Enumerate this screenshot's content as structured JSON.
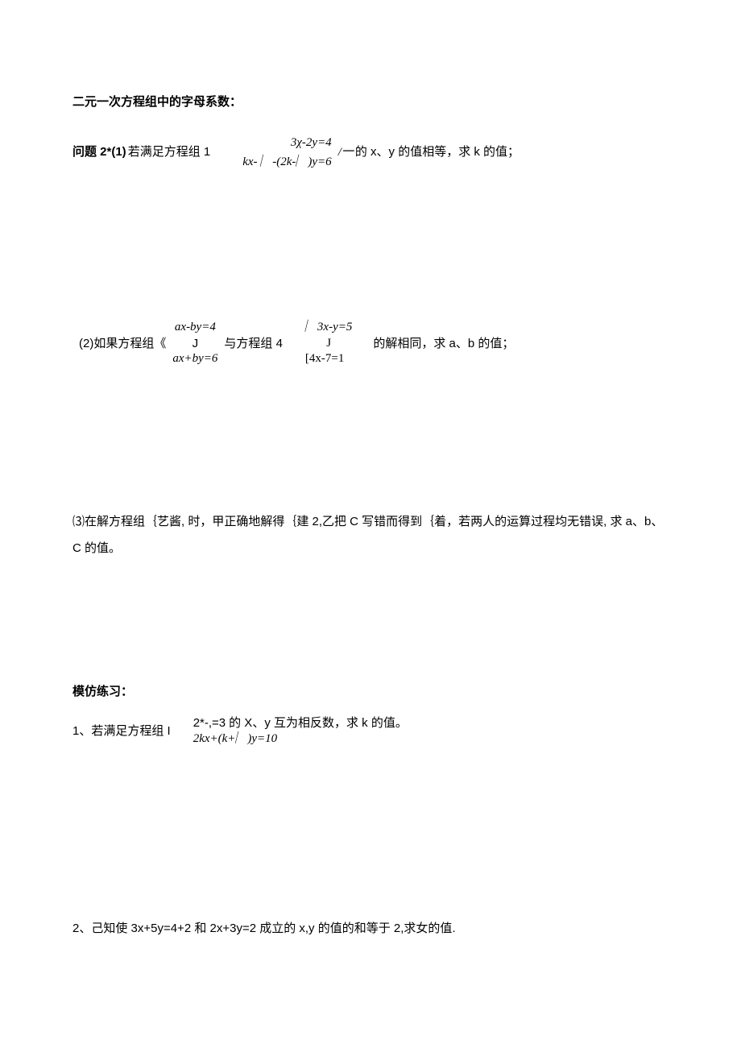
{
  "title": "二元一次方程组中的字母系数：",
  "q2_1": {
    "prefix": "问题 2*(1)",
    "text1": "若满足方程组 1",
    "eq_top": "3χ-2y=4",
    "eq_slash": "/一",
    "eq_bot": "kx- ︳-(2k-︳)y=6",
    "tail": "的 x、y 的值相等，求 k 的值；"
  },
  "q2_2": {
    "prefix": "(2)如果方程组《",
    "sys1_top": "ax-by=4",
    "sys1_mid": "J",
    "sys1_bot": "ax+by=6",
    "mid": "与方程组 4",
    "sys2_top": "︳3x-y=5",
    "sys2_mid": "J",
    "sys2_bot": "[4x-7=1",
    "tail": "的解相同，求 a、b 的值；"
  },
  "q3": "⑶在解方程组｛艺酱, 时，甲正确地解得｛建 2,乙把 C 写错而得到｛着，若两人的运算过程均无错误, 求 a、b、C 的值。",
  "practice_title": "模仿练习：",
  "p1": {
    "prefix": "1、若满足方程组 I",
    "top": "2*-,=3",
    "bot": "2kx+(k+︳)y=10",
    "tail": "的 X、y 互为相反数，求 k 的值。"
  },
  "p2": "2、己知使 3x+5y=4+2 和 2x+3y=2 成立的 x,y 的值的和等于 2,求女的值."
}
